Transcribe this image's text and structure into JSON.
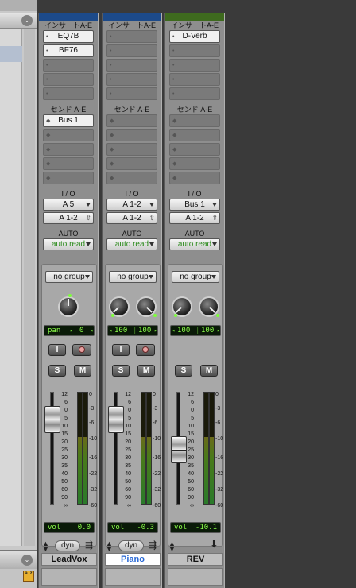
{
  "left_panel": {
    "collapse_glyph": "⌄",
    "sort_glyph": "a↓z"
  },
  "channels": [
    {
      "name": "LeadVox",
      "color": "#1c4a8a",
      "inserts_label": "インサートA-E",
      "inserts": [
        "EQ7B",
        "BF76",
        "",
        "",
        ""
      ],
      "sends_label": "センド A-E",
      "sends": [
        "Bus 1",
        "",
        "",
        "",
        ""
      ],
      "io_label": "I / O",
      "input": "A 5",
      "output": "A 1-2",
      "auto_label": "AUTO",
      "automation": "auto read",
      "group": "no group",
      "pan_readout": {
        "label": "pan",
        "value": "0"
      },
      "input_button": "I",
      "solo": "S",
      "mute": "M",
      "volume_label": "vol",
      "volume": "0.0",
      "meter_level": 0.6,
      "dyn_label": "dyn"
    },
    {
      "name": "Piano",
      "color": "#1c4a8a",
      "inserts_label": "インサートA-E",
      "inserts": [
        "",
        "",
        "",
        "",
        ""
      ],
      "sends_label": "センド A-E",
      "sends": [
        "",
        "",
        "",
        "",
        ""
      ],
      "io_label": "I / O",
      "input": "A 1-2",
      "output": "A 1-2",
      "auto_label": "AUTO",
      "automation": "auto read",
      "group": "no group",
      "pan_readout": {
        "left": "100",
        "right": "100"
      },
      "input_button": "I",
      "solo": "S",
      "mute": "M",
      "volume_label": "vol",
      "volume": "-0.3",
      "meter_level": 0.6,
      "dyn_label": "dyn"
    },
    {
      "name": "REV",
      "color": "#3e6a1e",
      "inserts_label": "インサートA-E",
      "inserts": [
        "D-Verb",
        "",
        "",
        "",
        ""
      ],
      "sends_label": "センド A-E",
      "sends": [
        "",
        "",
        "",
        "",
        ""
      ],
      "io_label": "I / O",
      "input": "Bus 1",
      "output": "A 1-2",
      "auto_label": "AUTO",
      "automation": "auto read",
      "group": "no group",
      "pan_readout": {
        "left": "100",
        "right": "100"
      },
      "solo": "S",
      "mute": "M",
      "volume_label": "vol",
      "volume": "-10.1",
      "meter_level": 0.6
    }
  ],
  "fader_scale": [
    "12",
    "6",
    "0",
    "5",
    "10",
    "15",
    "20",
    "25",
    "30",
    "35",
    "40",
    "50",
    "60",
    "90",
    "∞"
  ],
  "meter_scale": [
    "0",
    "-3",
    "-6",
    "-10",
    "-16",
    "-22",
    "-32",
    "-60"
  ]
}
